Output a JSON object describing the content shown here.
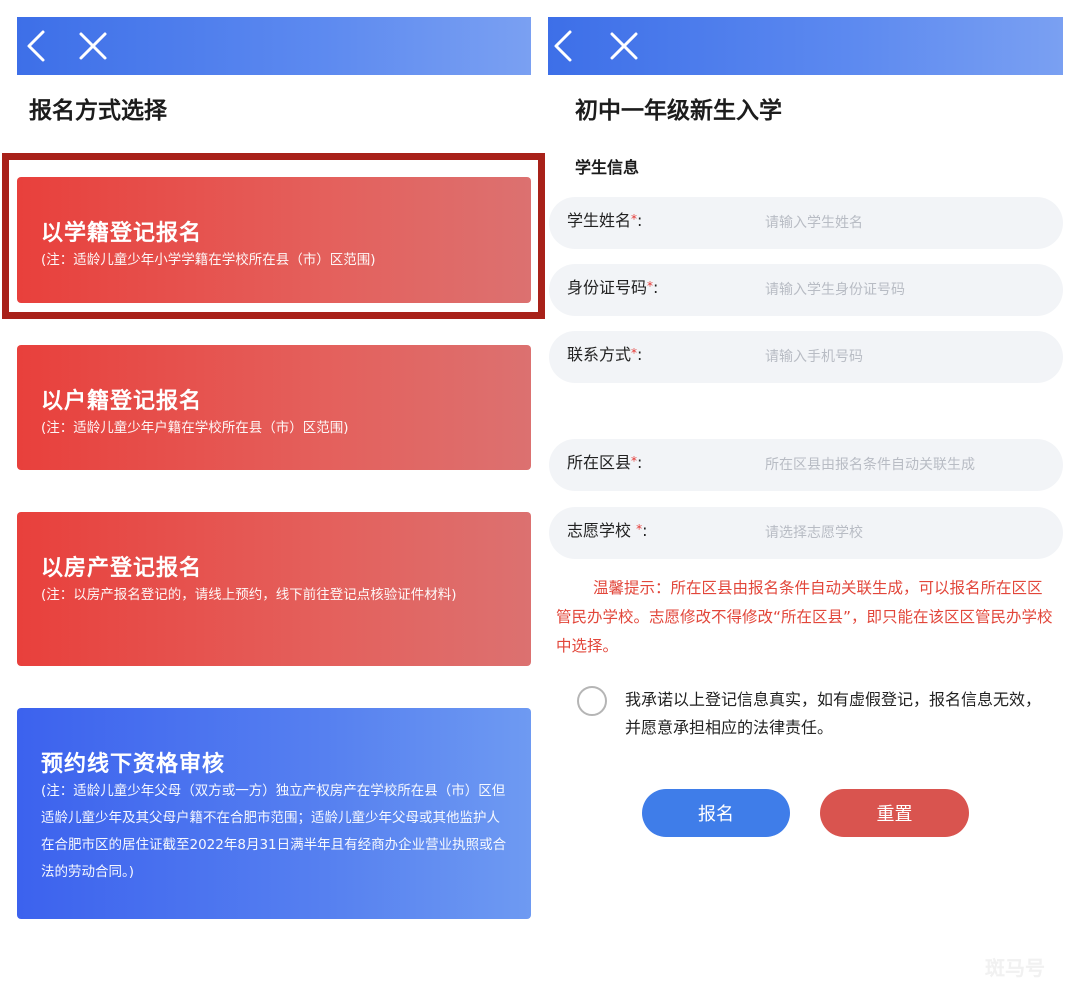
{
  "left": {
    "title": "报名方式选择",
    "cards": [
      {
        "title": "以学籍登记报名",
        "note": "(注：适龄儿童少年小学学籍在学校所在县（市）区范围)",
        "highlighted": true
      },
      {
        "title": "以户籍登记报名",
        "note": "(注：适龄儿童少年户籍在学校所在县（市）区范围)"
      },
      {
        "title": "以房产登记报名",
        "note": "(注：以房产报名登记的，请线上预约，线下前往登记点核验证件材料)"
      },
      {
        "title": "预约线下资格审核",
        "note": "(注：适龄儿童少年父母（双方或一方）独立产权房产在学校所在县（市）区但适龄儿童少年及其父母户籍不在合肥市范围；适龄儿童少年父母或其他监护人在合肥市区的居住证截至2022年8月31日满半年且有经商办企业营业执照或合法的劳动合同。)"
      }
    ]
  },
  "right": {
    "title": "初中一年级新生入学",
    "section": "学生信息",
    "fields": [
      {
        "label": "学生姓名",
        "required": "*",
        "colon": ":",
        "placeholder": "请输入学生姓名"
      },
      {
        "label": "身份证号码",
        "required": "*",
        "colon": ":",
        "placeholder": "请输入学生身份证号码"
      },
      {
        "label": "联系方式",
        "required": "*",
        "colon": ":",
        "placeholder": "请输入手机号码"
      },
      {
        "label": "所在区县",
        "required": "*",
        "colon": ":",
        "placeholder": "所在区县由报名条件自动关联生成"
      },
      {
        "label": "志愿学校 ",
        "required": "*",
        "colon": ":",
        "placeholder": "请选择志愿学校"
      }
    ],
    "tips": "温馨提示：所在区县由报名条件自动关联生成，可以报名所在区区管民办学校。志愿修改不得修改“所在区县”，即只能在该区区管民办学校中选择。",
    "promise": "我承诺以上登记信息真实，如有虚假登记，报名信息无效，并愿意承担相应的法律责任。",
    "promise_checked": false,
    "submit_label": "报名",
    "reset_label": "重置"
  },
  "watermark": "斑马号",
  "colors": {
    "topbar": "#4a78ec",
    "card_red": "#e4514d",
    "card_blue": "#4a72ef",
    "highlight_frame": "#a82119",
    "required": "#e53935",
    "tips": "#e2463a",
    "submit": "#3f7de9",
    "reset": "#d9544f"
  },
  "icons": [
    "back-chevron-icon",
    "close-x-icon"
  ]
}
